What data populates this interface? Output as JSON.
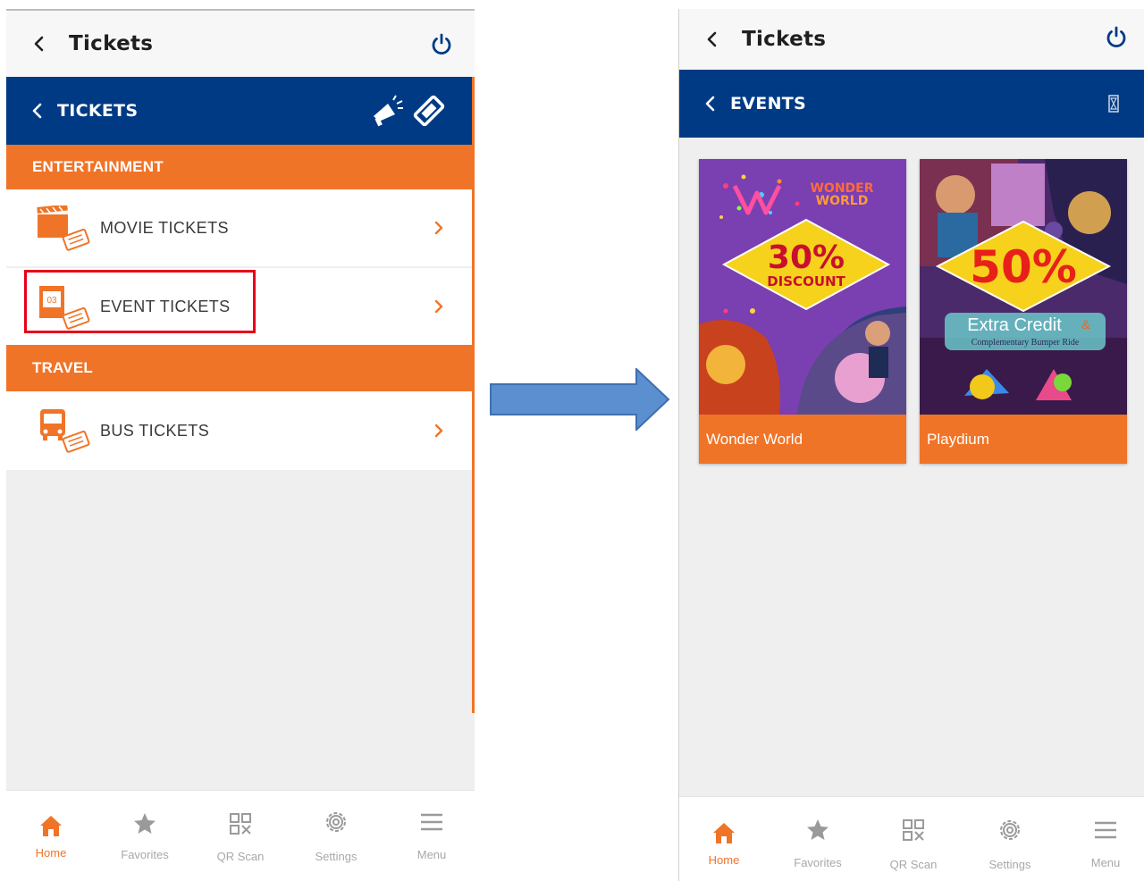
{
  "left_screen": {
    "header": {
      "title": "Tickets"
    },
    "subheader": {
      "title": "TICKETS"
    },
    "sections": [
      {
        "label": "ENTERTAINMENT"
      },
      {
        "label": "TRAVEL"
      }
    ],
    "items": [
      {
        "label": "MOVIE TICKETS",
        "icon": "movie-ticket-icon"
      },
      {
        "label": "EVENT TICKETS",
        "icon": "event-ticket-icon"
      },
      {
        "label": "BUS TICKETS",
        "icon": "bus-ticket-icon"
      }
    ],
    "event_icon_date": "03"
  },
  "right_screen": {
    "header": {
      "title": "Tickets"
    },
    "subheader": {
      "title": "EVENTS"
    },
    "events": [
      {
        "name": "Wonder World",
        "brand_line1": "WONDER",
        "brand_line2": "WORLD",
        "offer_big": "30%",
        "offer_small": "DISCOUNT"
      },
      {
        "name": "Playdium",
        "offer_big": "50%",
        "offer_line1": "Extra Credit",
        "offer_amp": "&",
        "offer_line2": "Complementary Bumper Ride"
      }
    ]
  },
  "bottom_nav": [
    {
      "label": "Home",
      "icon": "home-icon",
      "active": true
    },
    {
      "label": "Favorites",
      "icon": "star-icon",
      "active": false
    },
    {
      "label": "QR Scan",
      "icon": "qr-code-icon",
      "active": false
    },
    {
      "label": "Settings",
      "icon": "gear-icon",
      "active": false
    },
    {
      "label": "Menu",
      "icon": "hamburger-menu-icon",
      "active": false
    }
  ],
  "colors": {
    "brand_blue": "#003a84",
    "accent_orange": "#f07428",
    "highlight_red": "#e8001a",
    "arrow_blue": "#5b8fd0"
  }
}
